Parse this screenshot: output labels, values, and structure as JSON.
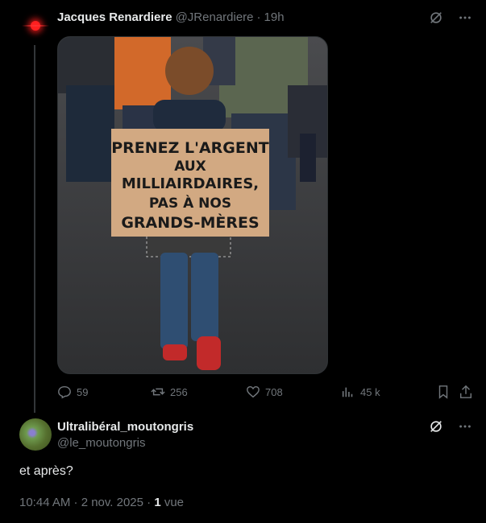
{
  "tweet1": {
    "author_name": "Jacques Renardiere",
    "author_handle": "@JRenardiere",
    "separator": "·",
    "time": "19h",
    "image_sign_lines": [
      "PRENEZ L'ARGENT",
      "AUX",
      "MILLIAIRDAIRES,",
      "PAS À NOS",
      "GRANDS-MÈRES"
    ],
    "stats": {
      "replies": "59",
      "reposts": "256",
      "likes": "708",
      "views": "45 k"
    }
  },
  "tweet2": {
    "author_name": "Ultralibéral_moutongris",
    "author_handle": "@le_moutongris",
    "text": "et après?",
    "timestamp": "10:44 AM · 2 nov. 2025 · ",
    "views_count": "1",
    "views_label": " vue"
  },
  "icons": [
    "grok-icon",
    "more-icon",
    "reply-icon",
    "repost-icon",
    "like-icon",
    "views-icon",
    "bookmark-icon",
    "share-icon"
  ]
}
